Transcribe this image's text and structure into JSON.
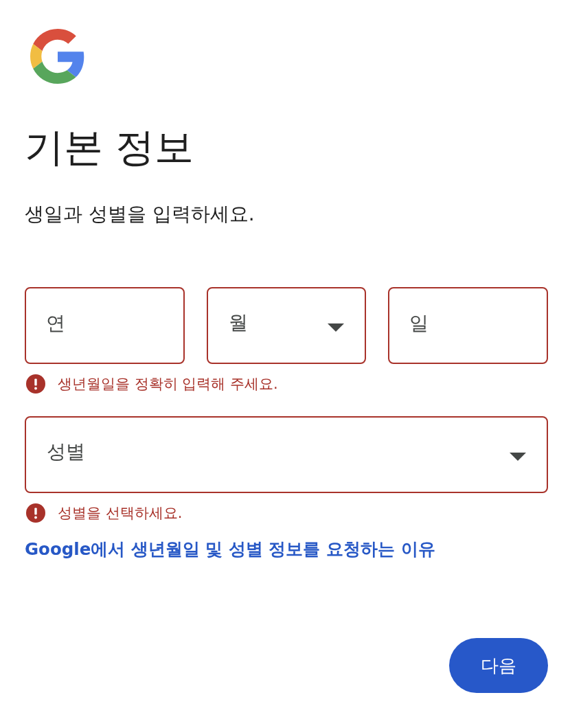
{
  "title": "기본 정보",
  "subtitle": "생일과 성별을 입력하세요.",
  "birthday": {
    "fields": [
      {
        "kind": "text",
        "placeholder": "연",
        "invalid": true
      },
      {
        "kind": "select",
        "placeholder": "월",
        "invalid": true
      },
      {
        "kind": "text",
        "placeholder": "일",
        "invalid": true
      }
    ],
    "error": "생년월일을 정확히 입력해 주세요."
  },
  "gender": {
    "field": {
      "kind": "select",
      "placeholder": "성별",
      "invalid": true
    },
    "error": "성별을 선택하세요."
  },
  "help_link": "Google에서 생년월일 및 성별 정보를 요청하는 이유",
  "buttons": [
    {
      "label": "다음"
    }
  ]
}
